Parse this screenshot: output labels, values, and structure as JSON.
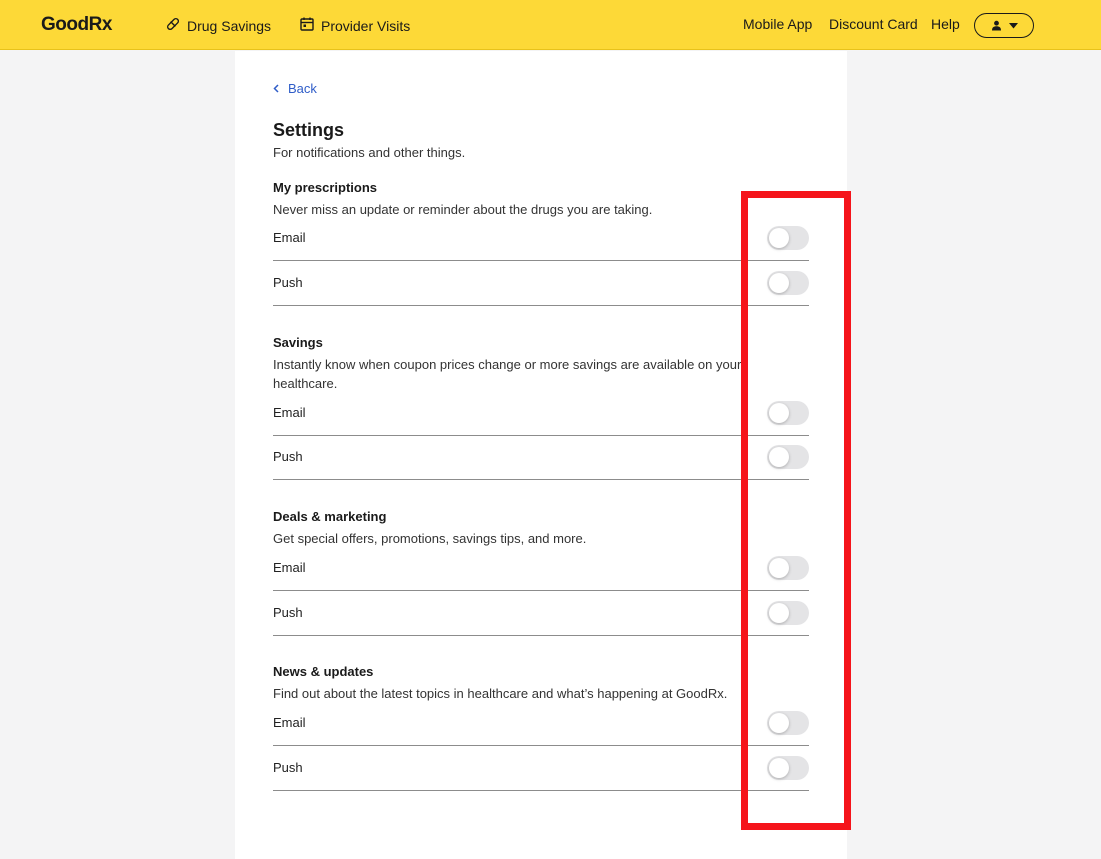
{
  "header": {
    "logo": "GoodRx",
    "nav": {
      "drug_savings": "Drug Savings",
      "provider_visits": "Provider Visits"
    },
    "right": {
      "mobile_app": "Mobile App",
      "discount_card": "Discount Card",
      "help": "Help"
    },
    "account_icon": "person-icon"
  },
  "page": {
    "back": "Back",
    "title": "Settings",
    "subtitle": "For notifications and other things."
  },
  "sections": [
    {
      "title": "My prescriptions",
      "desc": "Never miss an update or reminder about the drugs you are taking.",
      "rows": [
        {
          "label": "Email",
          "on": false
        },
        {
          "label": "Push",
          "on": false
        }
      ]
    },
    {
      "title": "Savings",
      "desc": "Instantly know when coupon prices change or more savings are available on your healthcare.",
      "rows": [
        {
          "label": "Email",
          "on": false
        },
        {
          "label": "Push",
          "on": false
        }
      ]
    },
    {
      "title": "Deals & marketing",
      "desc": "Get special offers, promotions, savings tips, and more.",
      "rows": [
        {
          "label": "Email",
          "on": false
        },
        {
          "label": "Push",
          "on": false
        }
      ]
    },
    {
      "title": "News & updates",
      "desc": "Find out about the latest topics in healthcare and what’s happening at GoodRx.",
      "rows": [
        {
          "label": "Email",
          "on": false
        },
        {
          "label": "Push",
          "on": false
        }
      ]
    }
  ],
  "colors": {
    "brand_yellow": "#fdd937",
    "link_blue": "#2f5dc8",
    "highlight_red": "#f5141b"
  }
}
